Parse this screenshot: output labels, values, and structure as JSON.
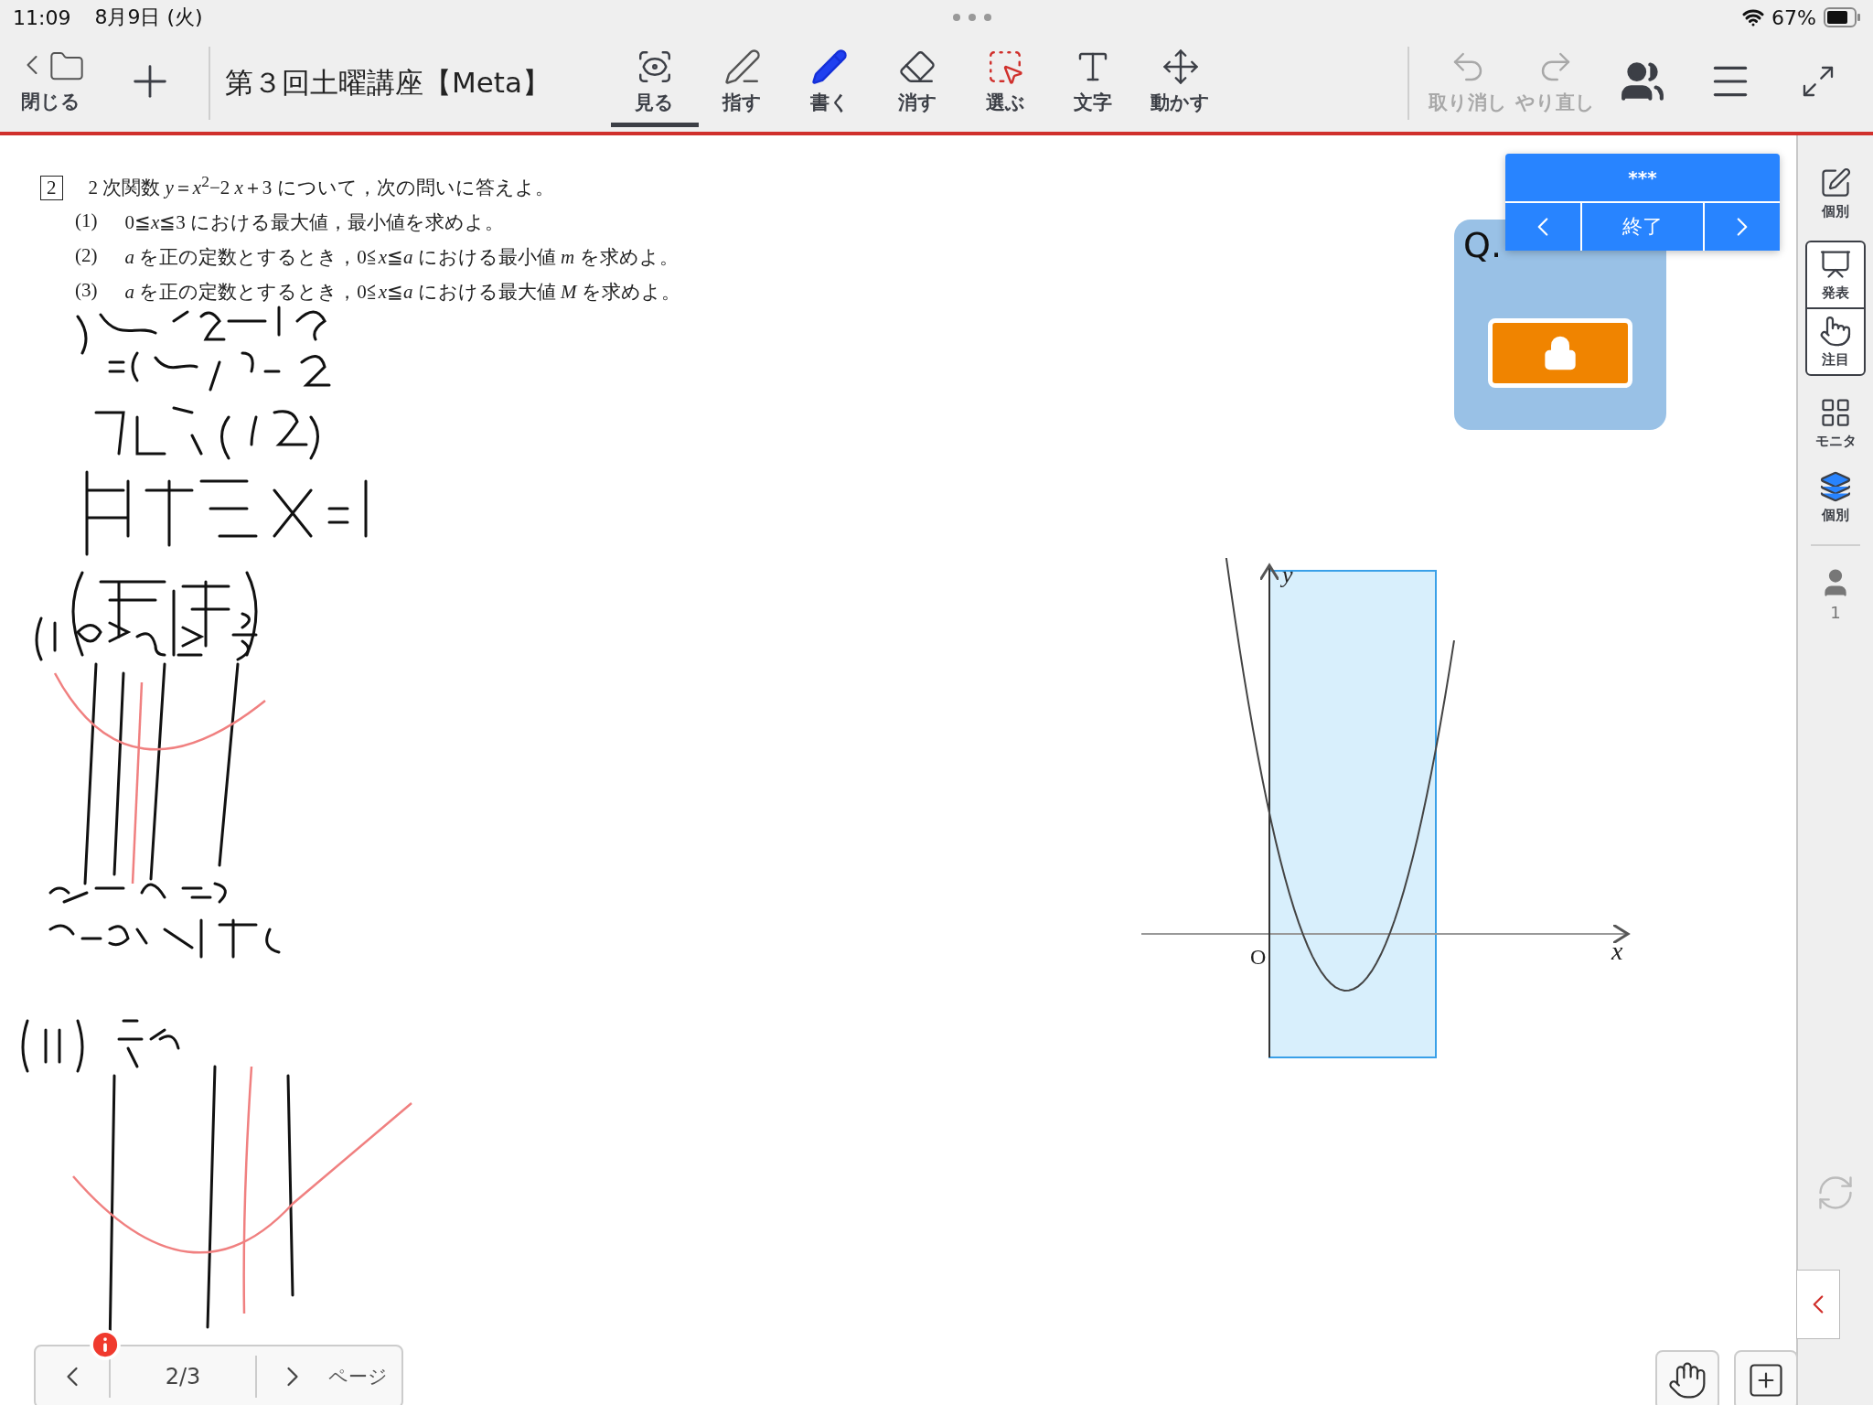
{
  "status_bar": {
    "time": "11:09",
    "date": "8月9日 (火)",
    "battery": "67%"
  },
  "toolbar": {
    "close_label": "閉じる",
    "title": "第３回土曜講座【Meta】",
    "tools": [
      {
        "kind": "view",
        "label": "見る",
        "selected": true
      },
      {
        "kind": "point",
        "label": "指す",
        "selected": false
      },
      {
        "kind": "write",
        "label": "書く",
        "selected": false
      },
      {
        "kind": "erase",
        "label": "消す",
        "selected": false
      },
      {
        "kind": "select",
        "label": "選ぶ",
        "selected": false
      },
      {
        "kind": "text",
        "label": "文字",
        "selected": false
      },
      {
        "kind": "move",
        "label": "動かす",
        "selected": false
      }
    ],
    "actions": [
      {
        "kind": "undo",
        "label": "取り消し",
        "disabled": true
      },
      {
        "kind": "redo",
        "label": "やり直し",
        "disabled": true
      }
    ]
  },
  "problem": {
    "number": "2",
    "lead": "2 次関数 *y*＝*x*$^{2}$−2 *x*＋3 について，次の問いに答えよ。",
    "items": [
      {
        "num": "(1)",
        "text": "0≦*x*≦3 における最大値，最小値を求めよ。"
      },
      {
        "num": "(2)",
        "text": "*a* を正の定数とするとき，0≦*x*≦*a* における最小値 *m* を求めよ。"
      },
      {
        "num": "(3)",
        "text": "*a* を正の定数とするとき，0≦*x*≦*a* における最大値 *M* を求めよ。"
      }
    ]
  },
  "graph": {
    "origin": "O",
    "x_label": "x",
    "y_label": "y"
  },
  "question_card": {
    "text": "Q."
  },
  "quiz_popup": {
    "title": "***",
    "finish": "終了"
  },
  "sidebar": {
    "items": [
      {
        "kind": "individual",
        "label": "個別"
      },
      {
        "kind": "present",
        "label": "発表"
      },
      {
        "kind": "focus",
        "label": "注目"
      },
      {
        "kind": "monitor",
        "label": "モニタ"
      },
      {
        "kind": "layers",
        "label": "個別"
      },
      {
        "kind": "users",
        "label": "1"
      }
    ]
  },
  "pager": {
    "page": "2/3",
    "label": "ページ"
  }
}
